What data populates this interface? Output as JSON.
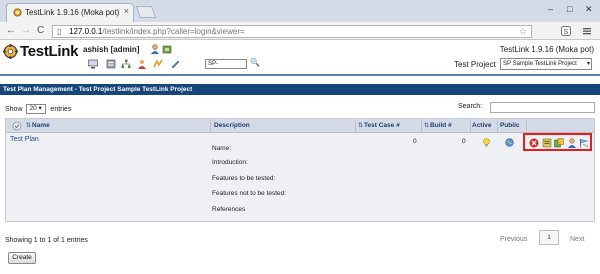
{
  "browser": {
    "tab_title": "TestLink 1.9.16 (Moka pot)",
    "tab_close": "×",
    "url_host": "127.0.0.1",
    "url_path": "/testlink/index.php?caller=login&viewer=",
    "back_glyph": "←",
    "forward_glyph": "→",
    "reload_glyph": "C",
    "star_glyph": "☆",
    "minimize": "–",
    "maximize": "□",
    "close": "✕"
  },
  "header": {
    "logo_text": "TestLink",
    "user": "ashish [admin]",
    "version": "TestLink 1.9.16 (Moka pot)",
    "search_value": "SP-",
    "search_icon_glyph": "🔍",
    "test_project_label": "Test Project",
    "test_project_value": "SP Sample TestLink Project",
    "select_arrow": "▾"
  },
  "title_bar": "Test Plan Management - Test Project Sample TestLink Project",
  "controls": {
    "show_label": "Show",
    "show_value": "20",
    "entries_label": "entries",
    "search_label": "Search:"
  },
  "table": {
    "columns": {
      "name": "Name",
      "description": "Description",
      "test_case": "Test Case #",
      "build": "Build #",
      "active": "Active",
      "public": "Public"
    },
    "sort_glyph": "⇅",
    "rows": [
      {
        "name": "Test Plan",
        "description": [
          "Name:",
          "Introduction:",
          "Features to be tested:",
          "Features not to be tested:",
          "References"
        ],
        "test_case_count": "0",
        "build_count": "0"
      }
    ]
  },
  "footer": {
    "info": "Showing 1 to 1 of 1 entries",
    "previous": "Previous",
    "page": "1",
    "next": "Next",
    "create_button": "Create"
  },
  "colors": {
    "title_bar": "#15457a",
    "highlight_border": "#e02020",
    "link": "#1d4e8c"
  }
}
